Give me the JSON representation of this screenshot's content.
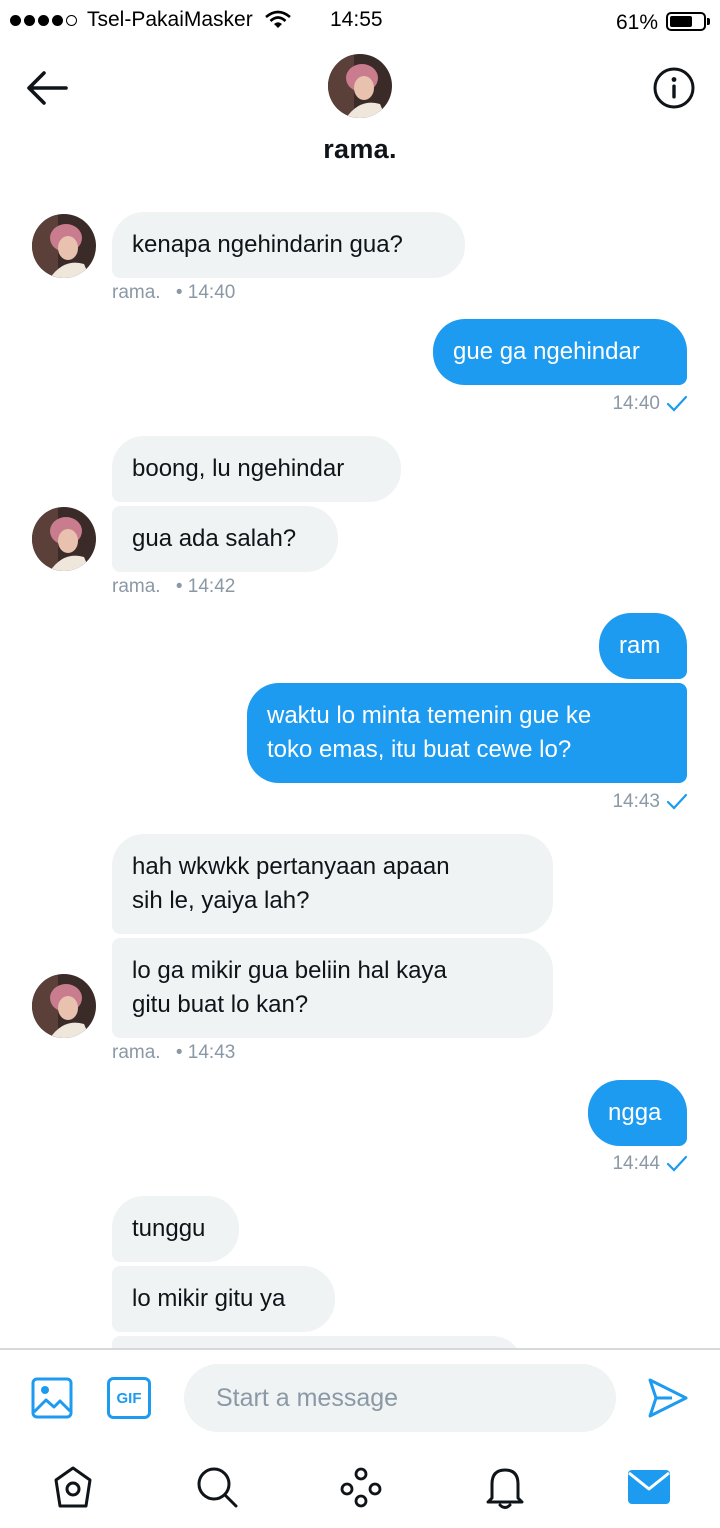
{
  "status_bar": {
    "carrier": "Tsel-PakaiMasker",
    "time": "14:55",
    "battery": "61%"
  },
  "header": {
    "name": "rama."
  },
  "messages": {
    "m1": {
      "text": "kenapa ngehindarin gua?",
      "meta_name": "rama.",
      "meta_time": "• 14:40"
    },
    "m2": {
      "text": "gue ga ngehindar",
      "time": "14:40"
    },
    "m3a": {
      "text": "boong, lu ngehindar"
    },
    "m3b": {
      "text": "gua ada salah?",
      "meta_name": "rama.",
      "meta_time": "• 14:42"
    },
    "m4a": {
      "text": "ram"
    },
    "m4b": {
      "text": "waktu lo minta temenin gue ke\ntoko emas, itu buat cewe lo?",
      "time": "14:43"
    },
    "m5a": {
      "text": "hah wkwkk pertanyaan apaan\nsih le, yaiya lah?"
    },
    "m5b": {
      "text": "lo ga mikir gua beliin hal kaya\ngitu buat lo kan?",
      "meta_name": "rama.",
      "meta_time": "• 14:43"
    },
    "m6": {
      "text": "ngga",
      "time": "14:44"
    },
    "m7a": {
      "text": "tunggu"
    },
    "m7b": {
      "text": "lo mikir gitu ya"
    }
  },
  "composer": {
    "placeholder": "Start a message",
    "gif_label": "GIF"
  },
  "colors": {
    "accent": "#1d9bf0",
    "incoming_bubble": "#eff3f4",
    "meta_text": "#8b98a5"
  },
  "icons": [
    "back-arrow-icon",
    "info-icon",
    "image-icon",
    "gif-icon",
    "send-icon",
    "home-icon",
    "search-icon",
    "spaces-icon",
    "bell-icon",
    "mail-icon"
  ]
}
